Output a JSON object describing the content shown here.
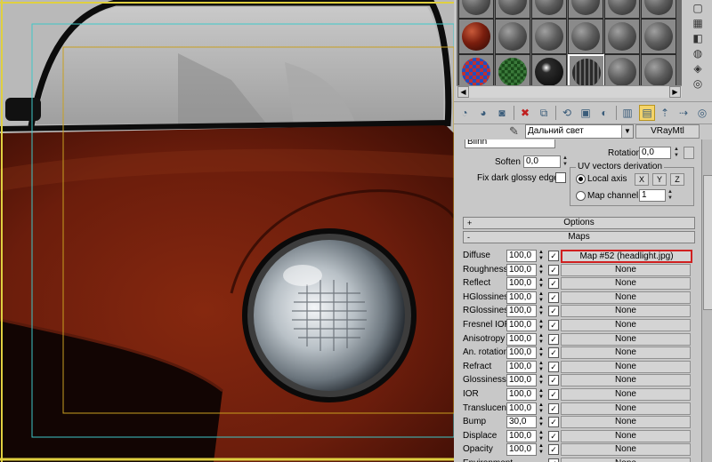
{
  "material_browser": {
    "swatch_rows": [
      [
        "sphere",
        "sphere",
        "sphere",
        "sphere",
        "sphere",
        "sphere"
      ],
      [
        "red-sphere",
        "sphere",
        "sphere",
        "sphere",
        "sphere",
        "sphere"
      ],
      [
        "checker-sphere",
        "checker-green-sphere",
        "dark-checker-sphere",
        "headlight-sphere",
        "sphere",
        "sphere"
      ]
    ],
    "selected_index": 15
  },
  "side_tools": [
    "pin-icon",
    "checker-icon",
    "sample-uv-icon",
    "sphere-icon",
    "cube-icon",
    "cylinder-icon"
  ],
  "toolbar": {
    "icons": [
      "get-material-icon",
      "put-material-icon",
      "assign-material-icon",
      "reset-map-icon",
      "copy-material-icon",
      "make-unique-icon",
      "put-library-icon",
      "material-effects-icon",
      "show-map-icon",
      "show-end-result-icon",
      "go-to-parent-icon",
      "go-forward-icon",
      "select-by-material-icon"
    ]
  },
  "material": {
    "name": "Дальний свет",
    "type": "VRayMtl"
  },
  "params": {
    "brdf_type": "Blinn",
    "rotation_label": "Rotation",
    "rotation_value": "0,0",
    "soften_label": "Soften",
    "soften_value": "0,0",
    "fix_dark_label": "Fix dark glossy edges",
    "uv_group_title": "UV vectors derivation",
    "local_axis_label": "Local axis",
    "axis_x": "X",
    "axis_y": "Y",
    "axis_z": "Z",
    "map_channel_label": "Map channel",
    "map_channel_value": "1"
  },
  "rollouts": {
    "options": {
      "sign": "+",
      "label": "Options"
    },
    "maps": {
      "sign": "-",
      "label": "Maps"
    }
  },
  "maps": [
    {
      "label": "Diffuse",
      "amount": "100,0",
      "checked": "✓",
      "map": "Map #52 (headlight.jpg)"
    },
    {
      "label": "Roughness",
      "amount": "100,0",
      "checked": "✓",
      "map": "None"
    },
    {
      "label": "Reflect",
      "amount": "100,0",
      "checked": "✓",
      "map": "None"
    },
    {
      "label": "HGlossiness",
      "amount": "100,0",
      "checked": "✓",
      "map": "None"
    },
    {
      "label": "RGlossiness",
      "amount": "100,0",
      "checked": "✓",
      "map": "None"
    },
    {
      "label": "Fresnel IOR",
      "amount": "100,0",
      "checked": "✓",
      "map": "None"
    },
    {
      "label": "Anisotropy",
      "amount": "100,0",
      "checked": "✓",
      "map": "None"
    },
    {
      "label": "An. rotation",
      "amount": "100,0",
      "checked": "✓",
      "map": "None"
    },
    {
      "label": "Refract",
      "amount": "100,0",
      "checked": "✓",
      "map": "None"
    },
    {
      "label": "Glossiness",
      "amount": "100,0",
      "checked": "✓",
      "map": "None"
    },
    {
      "label": "IOR",
      "amount": "100,0",
      "checked": "✓",
      "map": "None"
    },
    {
      "label": "Translucent",
      "amount": "100,0",
      "checked": "✓",
      "map": "None"
    },
    {
      "label": "Bump",
      "amount": "30,0",
      "checked": "✓",
      "map": "None"
    },
    {
      "label": "Displace",
      "amount": "100,0",
      "checked": "✓",
      "map": "None"
    },
    {
      "label": "Opacity",
      "amount": "100,0",
      "checked": "✓",
      "map": "None"
    },
    {
      "label": "Environment",
      "amount": "",
      "checked": "✓",
      "map": "None"
    }
  ],
  "colors": {
    "car_paint": "#6b1d0c",
    "highlight_border": "#d02020",
    "panel_bg": "#c8c8c8"
  }
}
